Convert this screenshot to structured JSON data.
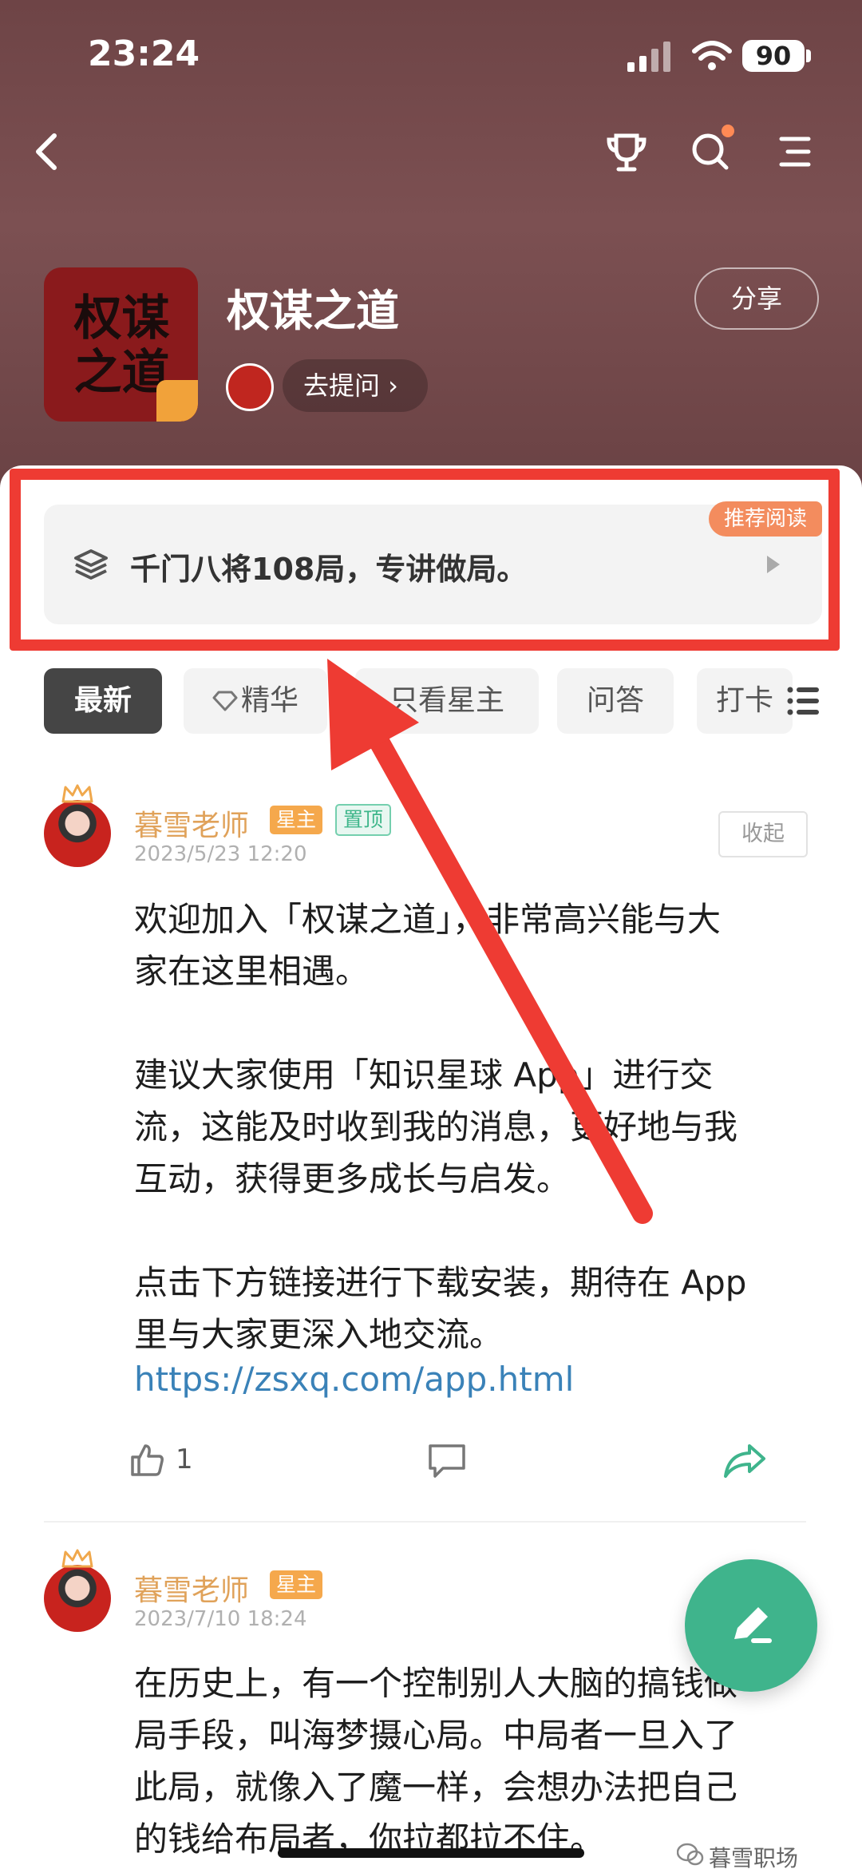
{
  "status_bar": {
    "time": "23:24",
    "battery": "90"
  },
  "header": {
    "group_name": "权谋之道",
    "share_label": "分享",
    "ask_label": "去提问 ›",
    "logo_text": "权谋之道"
  },
  "recommend": {
    "badge": "推荐阅读",
    "text": "千门八将108局，专讲做局。"
  },
  "tabs": [
    {
      "label": "最新",
      "active": true
    },
    {
      "label": "精华"
    },
    {
      "label": "只看星主"
    },
    {
      "label": "问答"
    },
    {
      "label": "打卡"
    }
  ],
  "posts": [
    {
      "author": "暮雪老师",
      "badges": [
        "星主",
        "置顶"
      ],
      "timestamp": "2023/5/23 12:20",
      "collapse_label": "收起",
      "lines": [
        "欢迎加入「权谋之道」，非常高兴能与大",
        "家在这里相遇。",
        "",
        "建议大家使用「知识星球 App」进行交",
        "流，这能及时收到我的消息，更好地与我",
        "互动，获得更多成长与启发。",
        "",
        "点击下方链接进行下载安装，期待在 App",
        "里与大家更深入地交流。"
      ],
      "link": "https://zsxq.com/app.html",
      "like_count": "1"
    },
    {
      "author": "暮雪老师",
      "badges": [
        "星主"
      ],
      "timestamp": "2023/7/10 18:24",
      "lines": [
        "在历史上，有一个控制别人大脑的搞钱做",
        "局手段，叫海梦摄心局。中局者一旦入了",
        "此局，就像入了魔一样，会想办法把自己",
        "的钱给布局者，你拉都拉不住。"
      ]
    }
  ],
  "watermark": "暮雪职场",
  "colors": {
    "accent": "#3fb48c",
    "highlight_red": "#ee3b33",
    "header_bg": "#7c5052",
    "author": "#e0a25a"
  }
}
